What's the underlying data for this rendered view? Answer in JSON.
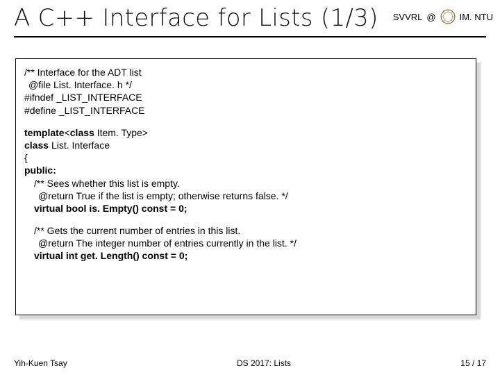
{
  "header": {
    "title": "A C++ Interface for Lists (1/3)",
    "right_label_1": "SVVRL",
    "right_label_2": "@",
    "right_label_3": "IM. NTU"
  },
  "code": {
    "c1": "/** Interface for the ADT list",
    "c2": "@file List. Interface. h */",
    "c3": "#ifndef _LIST_INTERFACE",
    "c4": "#define _LIST_INTERFACE",
    "t1a": "template",
    "t1b": "<",
    "t1c": "class ",
    "t1d": "Item. Type>",
    "t2a": "class ",
    "t2b": "List. Interface",
    "t3": "{",
    "t4": "public:",
    "m1a": "/** Sees whether this list is empty.",
    "m1b": "@return True if the list is empty; otherwise returns false. */",
    "m1c": "virtual bool is. Empty() const = 0;",
    "m2a": "/** Gets the current number of entries in this list.",
    "m2b": "@return The integer number of entries currently in the list. */",
    "m2c": "virtual int get. Length() const = 0;"
  },
  "footer": {
    "left": "Yih-Kuen Tsay",
    "center": "DS 2017: Lists",
    "right": "15 / 17"
  }
}
